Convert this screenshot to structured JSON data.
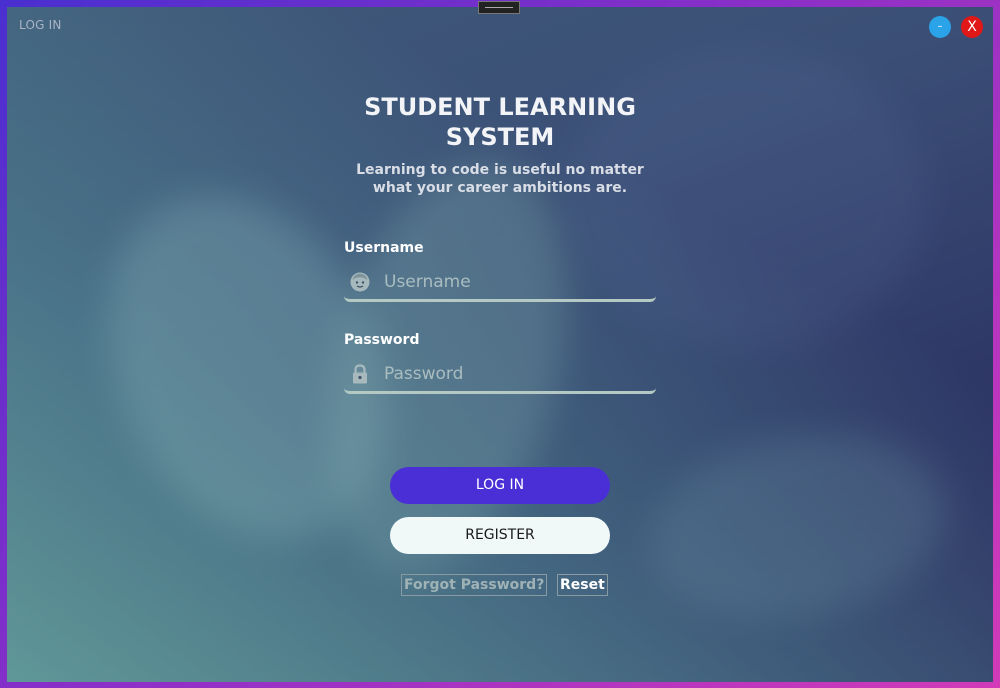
{
  "window": {
    "title": "LOG IN",
    "minimize_label": "–",
    "close_label": "X"
  },
  "header": {
    "title": "STUDENT LEARNING SYSTEM",
    "tagline": "Learning to code is useful no matter what your career ambitions are."
  },
  "form": {
    "username": {
      "label": "Username",
      "placeholder": "Username",
      "value": "",
      "icon": "face-icon"
    },
    "password": {
      "label": "Password",
      "placeholder": "Password",
      "value": "",
      "icon": "lock-icon"
    }
  },
  "actions": {
    "login_label": "LOG IN",
    "register_label": "REGISTER",
    "forgot_label": "Forgot Password?",
    "reset_label": "Reset"
  },
  "colors": {
    "frame_gradient_start": "#4a2fd0",
    "frame_gradient_end": "#d23ab8",
    "login_button": "#4a2fd6",
    "register_button": "#f1f8f8",
    "minimize_button": "#2aa3e8",
    "close_button": "#e01818"
  }
}
